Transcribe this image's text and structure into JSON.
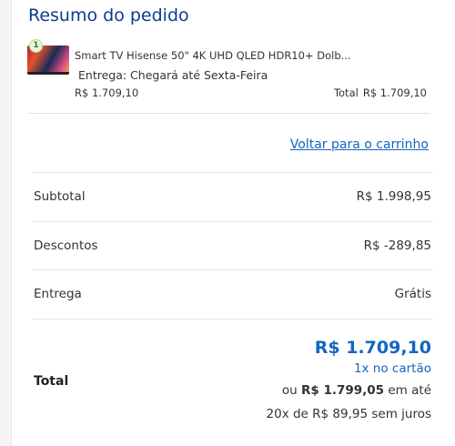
{
  "summary_title": "Resumo do pedido",
  "item": {
    "quantity": "1",
    "name": "Smart TV Hisense 50\" 4K UHD QLED HDR10+ Dolb...",
    "delivery": "Entrega: Chegará até Sexta-Feira",
    "unit_price": "R$ 1.709,10",
    "total_label": "Total",
    "total_value": "R$ 1.709,10"
  },
  "back_link": "Voltar para o carrinho",
  "rows": [
    {
      "label": "Subtotal",
      "value": "R$ 1.998,95"
    },
    {
      "label": "Descontos",
      "value": "R$ -289,85"
    },
    {
      "label": "Entrega",
      "value": "Grátis"
    }
  ],
  "total": {
    "label": "Total",
    "amount": "R$ 1.709,10",
    "installment": "1x no cartão",
    "alt_prefix": "ou",
    "alt_price": "R$ 1.799,05",
    "alt_suffix": "em até",
    "split": "20x de R$ 89,95 sem juros"
  },
  "colors": {
    "title": "#0b3d91",
    "accent": "#1565c0"
  }
}
